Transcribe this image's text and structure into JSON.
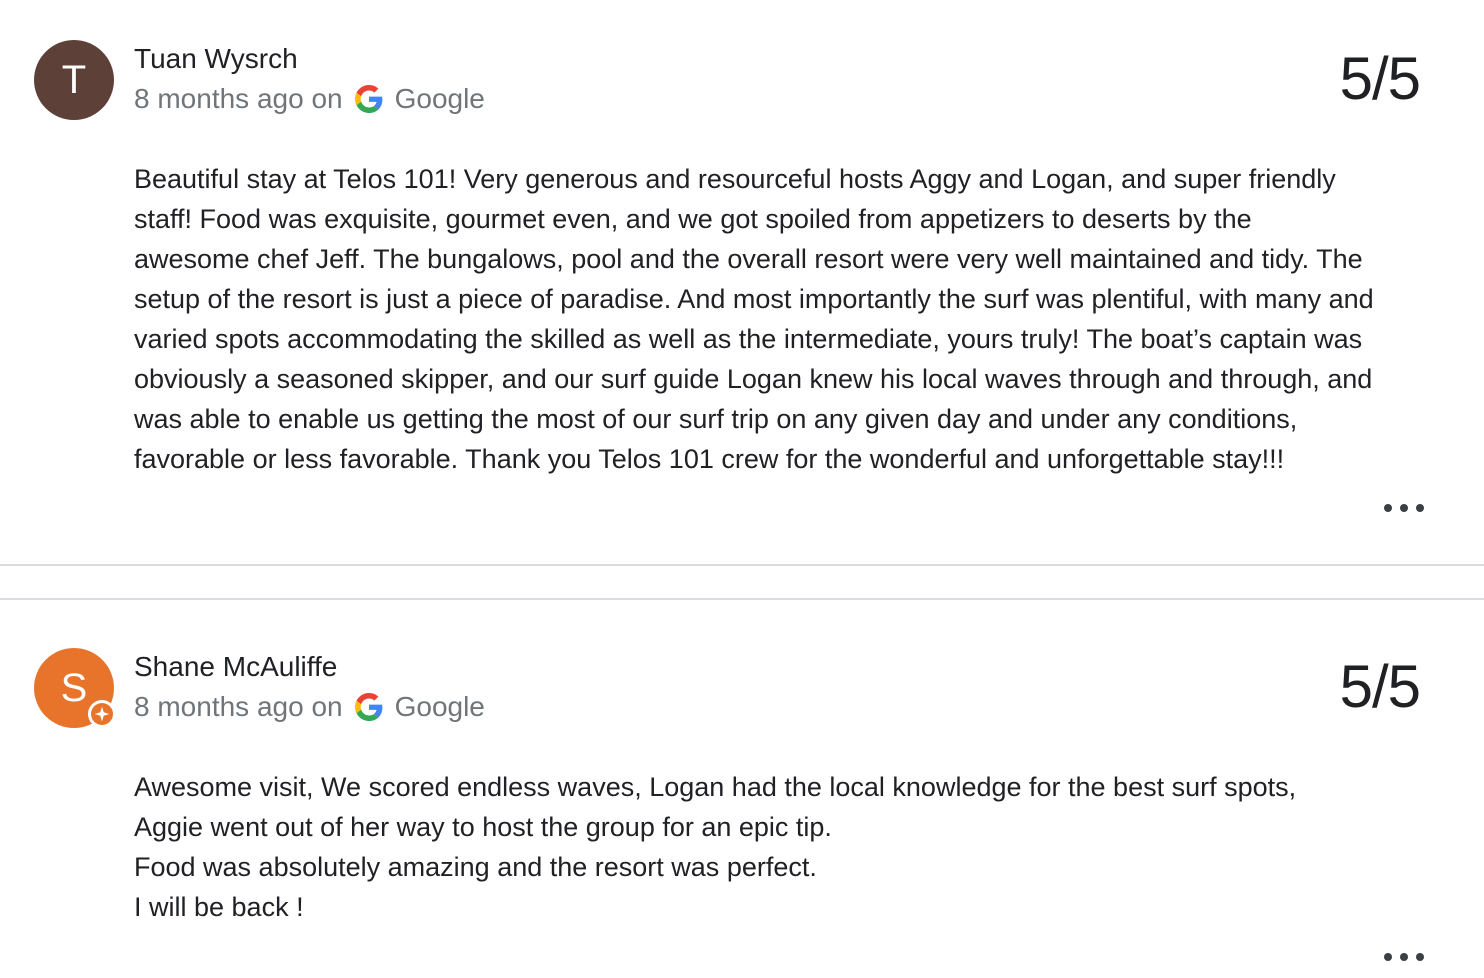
{
  "reviews": [
    {
      "author": "Tuan Wysrch",
      "avatar_letter": "T",
      "avatar_color": "#5d4037",
      "has_guide_badge": false,
      "time": "8 months ago on",
      "source": "Google",
      "score": "5/5",
      "text": "Beautiful stay at Telos 101! Very generous and resourceful hosts Aggy and Logan, and super friendly staff! Food was exquisite, gourmet even, and we got spoiled from appetizers to deserts by the awesome chef Jeff. The bungalows, pool and the overall resort were very well maintained and tidy. The setup of the resort is just a piece of paradise. And most importantly the surf was plentiful, with many and varied spots accommodating the skilled as well as the intermediate, yours truly! The boat’s captain was obviously a seasoned skipper, and our surf guide Logan knew his local waves through and through, and was able to enable us getting the most of our surf trip on any given day and under any conditions, favorable or less favorable. Thank you Telos 101 crew for the wonderful and unforgettable stay!!!",
      "more_icon": "more-horiz-icon"
    },
    {
      "author": "Shane McAuliffe",
      "avatar_letter": "S",
      "avatar_color": "#e8742c",
      "has_guide_badge": true,
      "badge_color": "#e8742c",
      "badge_icon": "local-guide-star-icon",
      "time": "8 months ago on",
      "source": "Google",
      "score": "5/5",
      "text": "Awesome visit, We scored endless waves, Logan had the local knowledge for the best surf spots,\nAggie went out of her way to host the group for an epic tip.\nFood was absolutely amazing and the resort was perfect.\nI will be back !",
      "more_icon": "more-horiz-icon"
    }
  ],
  "colors": {
    "divider": "#dadce0",
    "meta_text": "#70757a",
    "primary_text": "#202124",
    "google_blue": "#4285f4",
    "google_red": "#ea4335",
    "google_yellow": "#fbbc05",
    "google_green": "#34a853"
  }
}
